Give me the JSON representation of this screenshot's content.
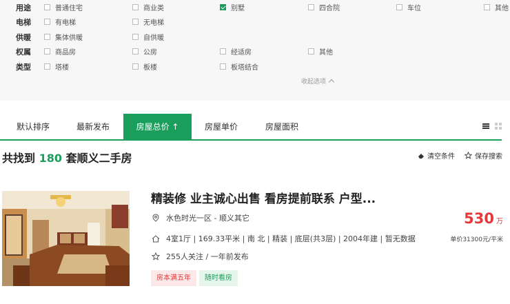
{
  "filters": [
    {
      "label": "用途",
      "options": [
        {
          "text": "普通住宅",
          "checked": false
        },
        {
          "text": "商业类",
          "checked": false
        },
        {
          "text": "别墅",
          "checked": true
        },
        {
          "text": "四合院",
          "checked": false
        },
        {
          "text": "车位",
          "checked": false
        },
        {
          "text": "其他",
          "checked": false
        }
      ]
    },
    {
      "label": "电梯",
      "options": [
        {
          "text": "有电梯",
          "checked": false
        },
        {
          "text": "无电梯",
          "checked": false
        }
      ]
    },
    {
      "label": "供暖",
      "options": [
        {
          "text": "集体供暖",
          "checked": false
        },
        {
          "text": "自供暖",
          "checked": false
        }
      ]
    },
    {
      "label": "权属",
      "options": [
        {
          "text": "商品房",
          "checked": false
        },
        {
          "text": "公房",
          "checked": false
        },
        {
          "text": "经适房",
          "checked": false
        },
        {
          "text": "其他",
          "checked": false
        }
      ]
    },
    {
      "label": "类型",
      "options": [
        {
          "text": "塔楼",
          "checked": false
        },
        {
          "text": "板楼",
          "checked": false
        },
        {
          "text": "板塔结合",
          "checked": false
        }
      ]
    }
  ],
  "collapse_label": "收起选项",
  "sort_tabs": [
    {
      "label": "默认排序"
    },
    {
      "label": "最新发布"
    },
    {
      "label": "房屋总价 ↑"
    },
    {
      "label": "房屋单价"
    },
    {
      "label": "房屋面积"
    }
  ],
  "active_tab": 2,
  "accent_color": "#1a9e5c",
  "price_color": "#e4393c",
  "result": {
    "prefix": "共找到",
    "count": "180",
    "suffix": "套顺义二手房"
  },
  "actions": {
    "clear": "清空条件",
    "save": "保存搜索"
  },
  "listing": {
    "title": "精装修 业主诚心出售 看房提前联系 户型...",
    "location": "水色时光一区 - 顺义其它",
    "details": "4室1厅 | 169.33平米 | 南 北 | 精装 | 底层(共3层) | 2004年建 | 暂无数据",
    "followers": "255人关注 / 一年前发布",
    "price": "530",
    "price_unit": "万",
    "unit_price": "单价31300元/平米",
    "tags": [
      "房本满五年",
      "随时看房"
    ]
  },
  "icons": {
    "location": "location-pin-icon",
    "house": "house-icon",
    "star": "star-icon",
    "clear": "eraser-icon",
    "save": "star-outline-icon",
    "list": "list-view-icon",
    "grid": "grid-view-icon"
  }
}
